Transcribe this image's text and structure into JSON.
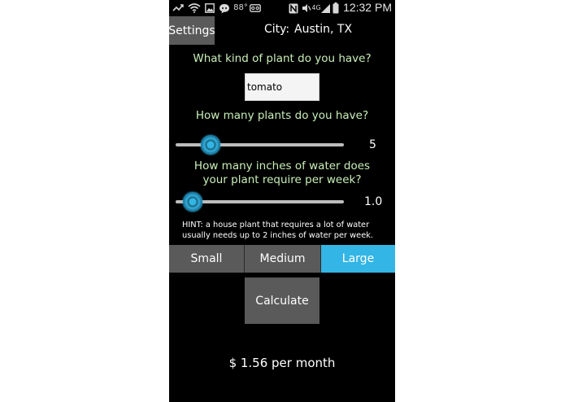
{
  "status_bar": {
    "time": "12:32 PM",
    "temperature": "88°",
    "icons": [
      "missed-call-icon",
      "wifi-icon",
      "image-icon",
      "chat-icon",
      "temperature-icon",
      "voicemail-icon",
      "nfc-icon",
      "mute-icon",
      "4g-icon",
      "signal-icon",
      "battery-icon"
    ]
  },
  "header": {
    "settings_label": "Settings",
    "city_label": "City:",
    "city_value": "Austin, TX"
  },
  "plant": {
    "question": "What kind of plant do you have?",
    "input_value": "tomato"
  },
  "plants_count": {
    "question": "How many plants do you have?",
    "value": "5",
    "fraction": 0.21
  },
  "water": {
    "question_line1": "How many inches of water does",
    "question_line2": "your plant require per week?",
    "value": "1.0",
    "fraction": 0.1
  },
  "hint": "HINT: a house plant that requires a lot of water usually needs up to 2 inches of water per week.",
  "size_buttons": {
    "small": "Small",
    "medium": "Medium",
    "large": "Large",
    "selected": "Large"
  },
  "colors": {
    "accent": "#33b5e5",
    "question_text": "#c9efb8",
    "button_gray": "#5a5a5a",
    "background": "#000000"
  },
  "calculate_label": "Calculate",
  "result": "$ 1.56 per month"
}
